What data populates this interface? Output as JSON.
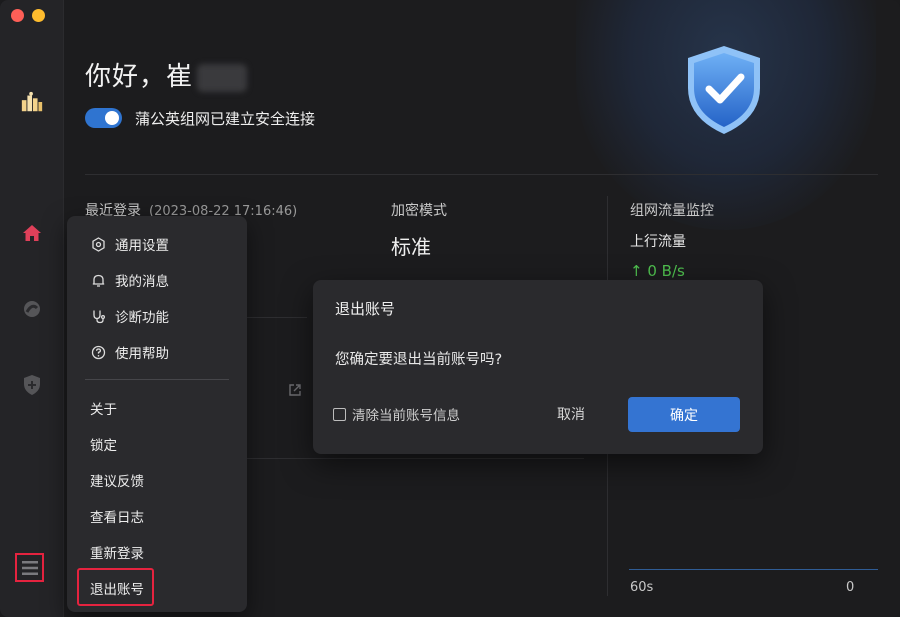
{
  "app": {
    "greeting": "你好，崔",
    "connection_status": "蒲公英组网已建立安全连接",
    "toggle_on": true
  },
  "stats": {
    "last_login_label": "最近登录",
    "last_login_time": "(2023-08-22 17:16:46)",
    "encryption_label": "加密模式",
    "encryption_value": "标准",
    "traffic_label": "组网流量监控",
    "upload_label": "上行流量",
    "upload_speed": "↑ 0 B/s",
    "axis_left": "60s",
    "axis_right": "0"
  },
  "sidebar": {
    "icons": [
      "logo-icon",
      "home-icon",
      "network-icon",
      "shield-plus-icon",
      "menu-icon"
    ]
  },
  "menu": {
    "items": [
      {
        "label": "通用设置",
        "icon": "settings-icon"
      },
      {
        "label": "我的消息",
        "icon": "bell-icon"
      },
      {
        "label": "诊断功能",
        "icon": "stethoscope-icon"
      },
      {
        "label": "使用帮助",
        "icon": "help-icon"
      },
      {
        "label": "关于"
      },
      {
        "label": "锁定"
      },
      {
        "label": "建议反馈"
      },
      {
        "label": "查看日志"
      },
      {
        "label": "重新登录"
      },
      {
        "label": "退出账号"
      }
    ]
  },
  "dialog": {
    "title": "退出账号",
    "message": "您确定要退出当前账号吗?",
    "checkbox_label": "清除当前账号信息",
    "cancel": "取消",
    "confirm": "确定"
  },
  "colors": {
    "accent": "#3474d2",
    "highlight_border": "#e5233f",
    "speed_green": "#4fc04f"
  }
}
